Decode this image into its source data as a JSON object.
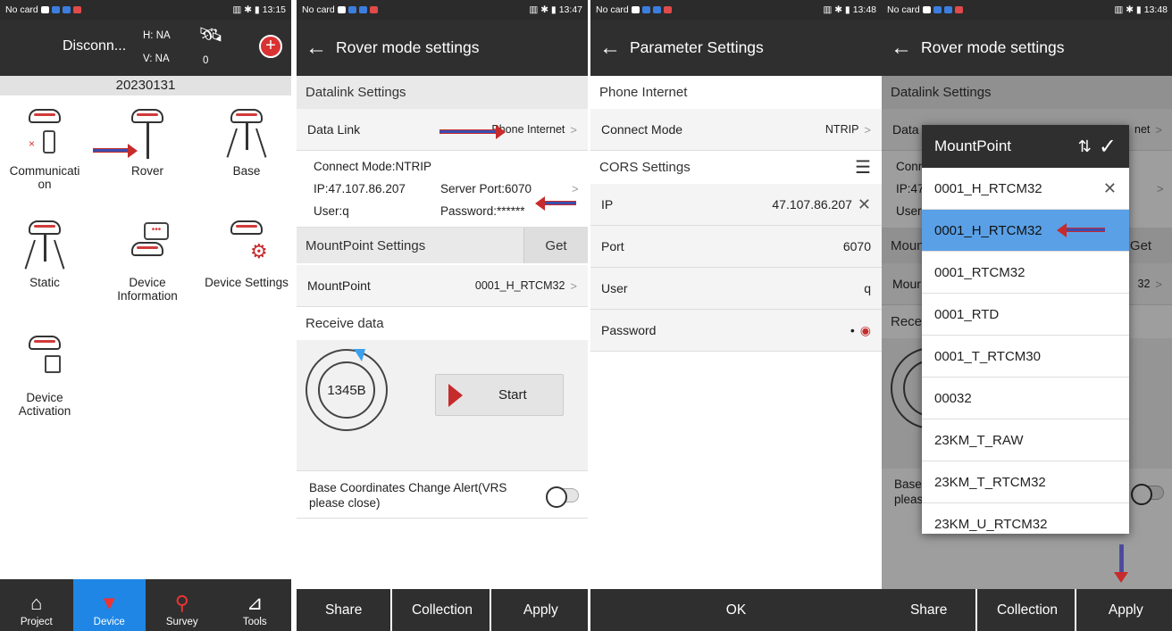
{
  "status": {
    "carrier": "No card",
    "times": [
      "13:15",
      "13:47",
      "13:48",
      "13:48"
    ]
  },
  "panel1": {
    "conn_title": "Disconn...",
    "h_label": "H: NA",
    "v_label": "V: NA",
    "sat_count": "0",
    "date": "20230131",
    "tiles": [
      {
        "label": "Communication",
        "icon": "communication-icon"
      },
      {
        "label": "Rover",
        "icon": "rover-icon"
      },
      {
        "label": "Base",
        "icon": "base-icon"
      },
      {
        "label": "Static",
        "icon": "static-icon"
      },
      {
        "label": "Device Information",
        "icon": "device-info-icon"
      },
      {
        "label": "Device Settings",
        "icon": "device-settings-icon"
      },
      {
        "label": "Device Activation",
        "icon": "device-activation-icon"
      }
    ],
    "nav": [
      {
        "label": "Project",
        "icon": "project-icon"
      },
      {
        "label": "Device",
        "icon": "device-icon"
      },
      {
        "label": "Survey",
        "icon": "survey-icon"
      },
      {
        "label": "Tools",
        "icon": "tools-icon"
      }
    ]
  },
  "panel2": {
    "title": "Rover mode settings",
    "datalink_section": "Datalink Settings",
    "data_link_label": "Data Link",
    "data_link_value": "Phone Internet",
    "connect_mode": "Connect Mode:NTRIP",
    "ip": "IP:47.107.86.207",
    "server_port": "Server Port:6070",
    "user": "User:q",
    "password": "Password:******",
    "mountpoint_section": "MountPoint Settings",
    "get_label": "Get",
    "mountpoint_label": "MountPoint",
    "mountpoint_value": "0001_H_RTCM32",
    "receive_section": "Receive data",
    "bytes": "1345B",
    "start_label": "Start",
    "alert_text": "Base Coordinates Change Alert(VRS please close)",
    "buttons": [
      "Share",
      "Collection",
      "Apply"
    ]
  },
  "panel3": {
    "title": "Parameter Settings",
    "phone_section": "Phone Internet",
    "connect_mode_label": "Connect Mode",
    "connect_mode_value": "NTRIP",
    "cors_section": "CORS Settings",
    "ip_label": "IP",
    "ip_value": "47.107.86.207",
    "port_label": "Port",
    "port_value": "6070",
    "user_label": "User",
    "user_value": "q",
    "password_label": "Password",
    "password_value": "•",
    "ok_label": "OK"
  },
  "panel4": {
    "title": "Rover mode settings",
    "bg_section": "Datalink Settings",
    "bg_data": "Data",
    "bg_net": "net",
    "bg_conn": "Conn",
    "bg_ip": "IP:47",
    "bg_user": "User",
    "bg_moun": "Moun",
    "bg_get": "Get",
    "bg_mour": "Mour",
    "bg_m32": "32",
    "bg_recei": "Recei",
    "bg_one": "1",
    "bg_base": "Base",
    "bg_pleas": "pleas",
    "dialog_title": "MountPoint",
    "items": [
      "0001_H_RTCM32",
      "0001_H_RTCM32",
      "0001_RTCM32",
      "0001_RTD",
      "0001_T_RTCM30",
      "00032",
      "23KM_T_RAW",
      "23KM_T_RTCM32",
      "23KM_U_RTCM32"
    ],
    "buttons": [
      "Share",
      "Collection",
      "Apply"
    ]
  }
}
